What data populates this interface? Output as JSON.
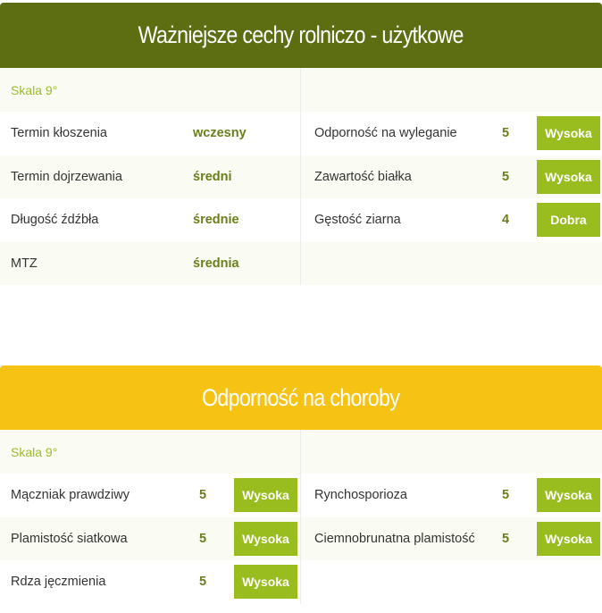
{
  "traits": {
    "title": "Ważniejsze cechy rolniczo - użytkowe",
    "header_color": "#5c6d12",
    "scale_label": "Skala 9°",
    "left": [
      {
        "name": "Termin kłoszenia",
        "value": "wczesny"
      },
      {
        "name": "Termin dojrzewania",
        "value": "średni"
      },
      {
        "name": "Długość źdźbła",
        "value": "średnie"
      },
      {
        "name": "MTZ",
        "value": "średnia"
      }
    ],
    "right": [
      {
        "name": "Odporność na wyleganie",
        "score": "5",
        "rating": "Wysoka"
      },
      {
        "name": "Zawartość białka",
        "score": "5",
        "rating": "Wysoka"
      },
      {
        "name": "Gęstość ziarna",
        "score": "4",
        "rating": "Dobra"
      }
    ]
  },
  "disease": {
    "title": "Odporność na choroby",
    "header_color": "#f6c315",
    "scale_label": "Skala 9°",
    "left": [
      {
        "name": "Mączniak prawdziwy",
        "score": "5",
        "rating": "Wysoka"
      },
      {
        "name": "Plamistość siatkowa",
        "score": "5",
        "rating": "Wysoka"
      },
      {
        "name": "Rdza jęczmienia",
        "score": "5",
        "rating": "Wysoka"
      }
    ],
    "right": [
      {
        "name": "Rynchosporioza",
        "score": "5",
        "rating": "Wysoka"
      },
      {
        "name": "Ciemnobrunatna plamistość",
        "score": "5",
        "rating": "Wysoka"
      }
    ]
  },
  "colors": {
    "badge": "#99bd1e",
    "value_text": "#6a7f1b",
    "scale_text": "#9bbb2b",
    "row_alt": "#fafbf3"
  }
}
